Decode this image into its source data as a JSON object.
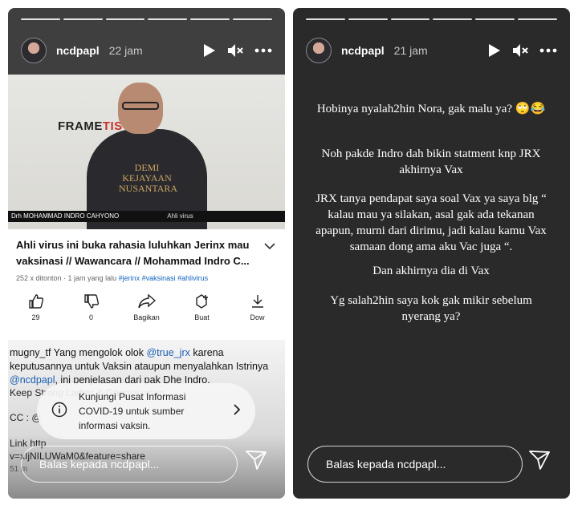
{
  "story_left": {
    "username": "ncdpapl",
    "time": "22 jam",
    "video": {
      "brand_a": "FRAME",
      "brand_b": "TIS",
      "shirt_text": "DEMI KEJAYAAN NUSANTARA",
      "caption_name": "Drh MOHAMMAD INDRO CAHYONO",
      "caption_role": "Ahli virus"
    },
    "youtube": {
      "title": "Ahli virus ini buka rahasia luluhkan Jerinx mau vaksinasi // Wawancara // Mohammad Indro C...",
      "meta": "252 x ditonton · 1 jam yang lalu",
      "tags": "#jerinx #vaksinasi #ahlivirus",
      "actions": [
        {
          "label": "29"
        },
        {
          "label": "0"
        },
        {
          "label": "Bagikan"
        },
        {
          "label": "Buat"
        },
        {
          "label": "Dow"
        }
      ]
    },
    "comment": {
      "user": "mugny_tf",
      "part1": " Yang mengolok olok ",
      "mention1": "@true_jrx",
      "part2": " karena keputusannya untuk Vaksin ataupun menyalahkan Istrinya ",
      "mention2": "@ncdpapl",
      "part3": ", ini penjelasan dari pak Dhe Indro.",
      "line_keep": "Keep Strong Ladies & Gangsterman",
      "line_cc": "CC : @",
      "line_link": "Link http",
      "line_url": "v=xIjNILUWaM0&feature=share",
      "line_count": "51 m"
    },
    "banner": "Kunjungi Pusat Informasi COVID-19 untuk sumber informasi vaksin.",
    "reply_placeholder": "Balas kepada ncdpapl..."
  },
  "story_right": {
    "username": "ncdpapl",
    "time": "21 jam",
    "lines": [
      "Hobinya nyalah2hin Nora, gak malu ya? 🙄😂",
      "Noh pakde Indro dah bikin statment knp JRX akhirnya Vax",
      "JRX tanya pendapat saya soal Vax ya saya blg “ kalau mau ya silakan, asal gak ada tekanan apapun, murni dari dirimu, jadi kalau kamu Vax samaan dong ama aku Vac juga “.",
      "Dan akhirnya dia di Vax",
      "Yg salah2hin saya kok gak mikir sebelum nyerang ya?"
    ],
    "reply_placeholder": "Balas kepada ncdpapl..."
  }
}
